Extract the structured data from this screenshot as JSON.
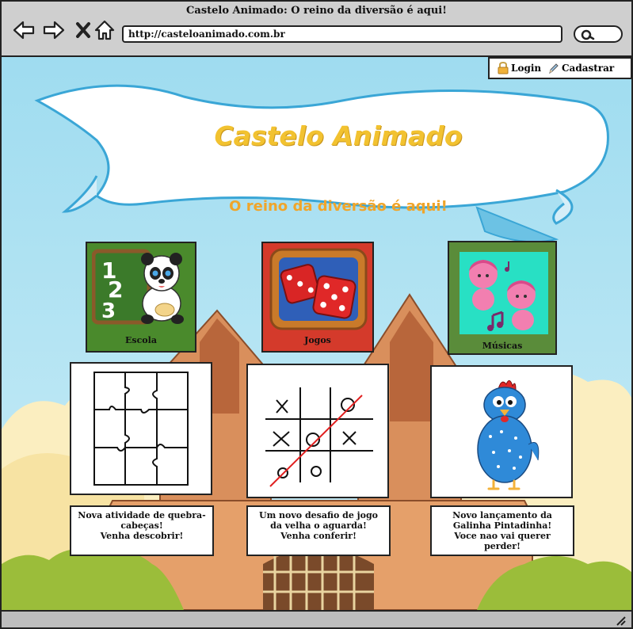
{
  "window": {
    "title": "Castelo Animado: O reino da diversão é aqui!",
    "url": "http://casteloanimado.com.br"
  },
  "toolbar": {
    "back_icon": "arrow-left-icon",
    "forward_icon": "arrow-right-icon",
    "stop_icon": "close-icon",
    "home_icon": "home-icon",
    "search_icon": "search-icon"
  },
  "auth": {
    "login_label": "Login",
    "login_icon": "lock-icon",
    "register_label": "Cadastrar",
    "register_icon": "pencil-icon"
  },
  "hero": {
    "title": "Castelo Animado",
    "subtitle": "O reino da diversão é aqui!"
  },
  "categories": [
    {
      "label": "Escola",
      "color": "#4a8a2c"
    },
    {
      "label": "Jogos",
      "color": "#d43a2b"
    },
    {
      "label": "Músicas",
      "color": "#5a8c3a"
    }
  ],
  "news": [
    {
      "text": "Nova atividade de quebra-\ncabeças!\nVenha descobrir!"
    },
    {
      "text": "Um novo desafio de jogo\nda velha o aguarda!\nVenha conferir!"
    },
    {
      "text": "Novo lançamento da\nGalinha Pintadinha!\nVoce nao vai querer\nperder!"
    }
  ],
  "colors": {
    "title": "#f2c230",
    "subtitle": "#f0a52a",
    "sky": "#9fdcf0"
  }
}
